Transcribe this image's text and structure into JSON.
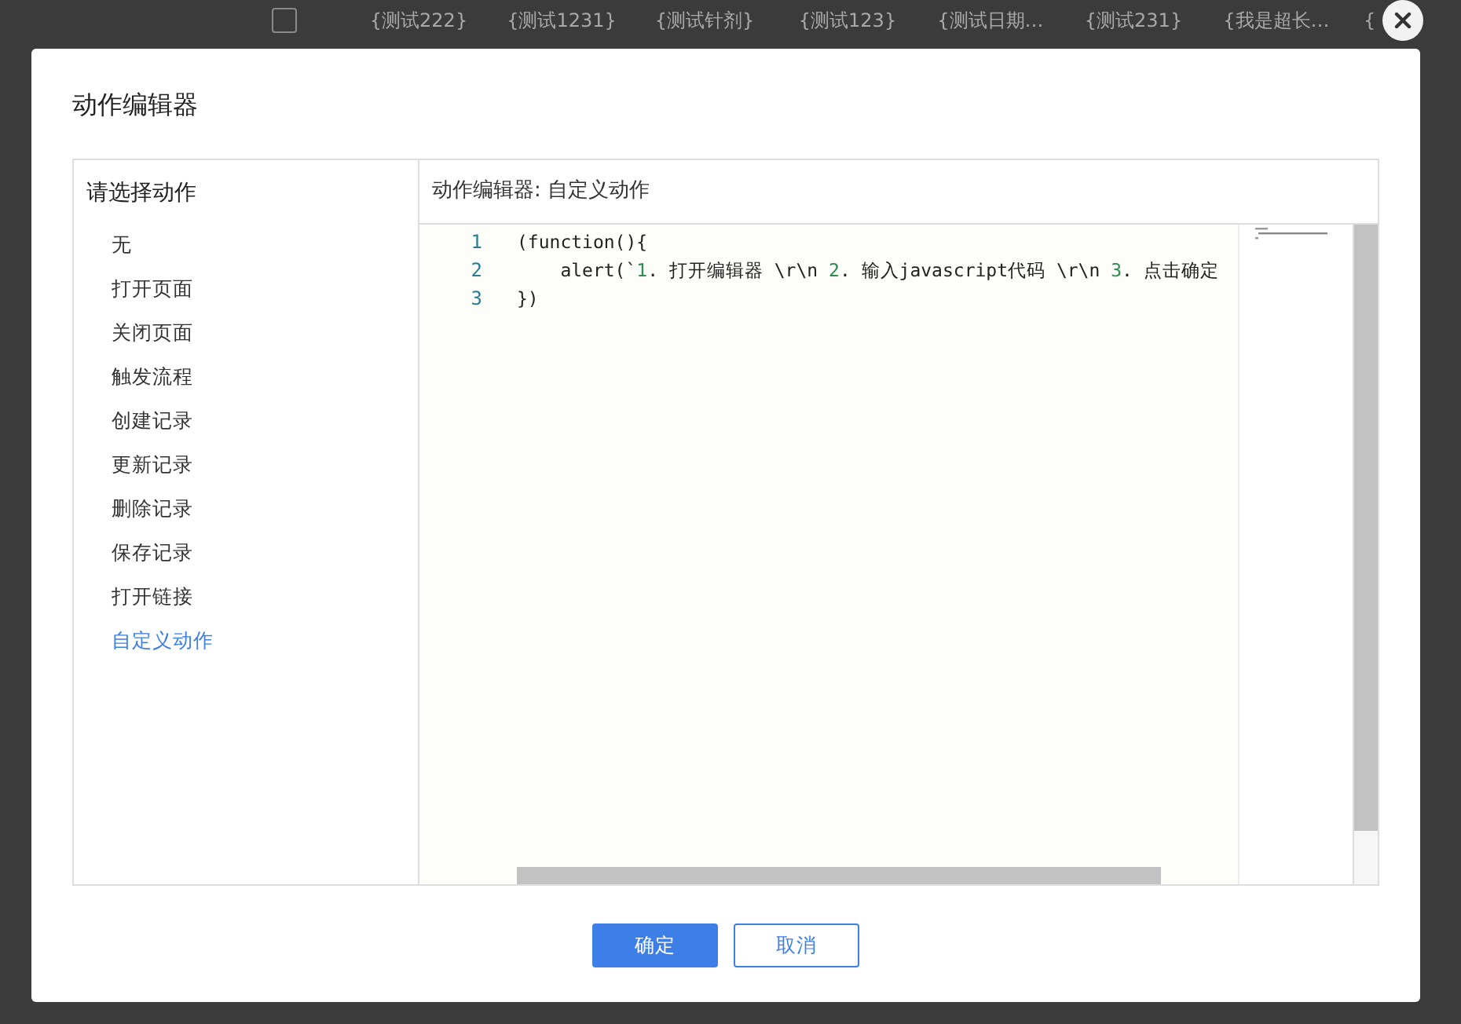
{
  "background_table": {
    "row": {
      "checked": false,
      "cells": [
        "{测试222}",
        "{测试1231}",
        "{测试针剂}",
        "{测试123}",
        "{测试日期…",
        "{测试231}",
        "{我是超长…",
        "{"
      ]
    }
  },
  "dialog": {
    "title": "动作编辑器",
    "action_list": {
      "heading": "请选择动作",
      "items": [
        {
          "label": "无",
          "selected": false
        },
        {
          "label": "打开页面",
          "selected": false
        },
        {
          "label": "关闭页面",
          "selected": false
        },
        {
          "label": "触发流程",
          "selected": false
        },
        {
          "label": "创建记录",
          "selected": false
        },
        {
          "label": "更新记录",
          "selected": false
        },
        {
          "label": "删除记录",
          "selected": false
        },
        {
          "label": "保存记录",
          "selected": false
        },
        {
          "label": "打开链接",
          "selected": false
        },
        {
          "label": "自定义动作",
          "selected": true
        }
      ]
    },
    "editor": {
      "heading": "动作编辑器: 自定义动作",
      "lines": [
        {
          "number": "1",
          "tokens": [
            {
              "kind": "plain",
              "text": "(function(){"
            }
          ]
        },
        {
          "number": "2",
          "tokens": [
            {
              "kind": "plain",
              "text": "    alert(`"
            },
            {
              "kind": "number",
              "text": "1"
            },
            {
              "kind": "plain",
              "text": ". 打开编辑器 \\r\\n "
            },
            {
              "kind": "number",
              "text": "2"
            },
            {
              "kind": "plain",
              "text": ". 输入javascript代码 \\r\\n "
            },
            {
              "kind": "number",
              "text": "3"
            },
            {
              "kind": "plain",
              "text": ". 点击确定"
            }
          ]
        },
        {
          "number": "3",
          "tokens": [
            {
              "kind": "plain",
              "text": "})"
            }
          ]
        }
      ]
    },
    "buttons": [
      {
        "label": "确定",
        "kind": "primary"
      },
      {
        "label": "取消",
        "kind": "secondary"
      }
    ]
  }
}
